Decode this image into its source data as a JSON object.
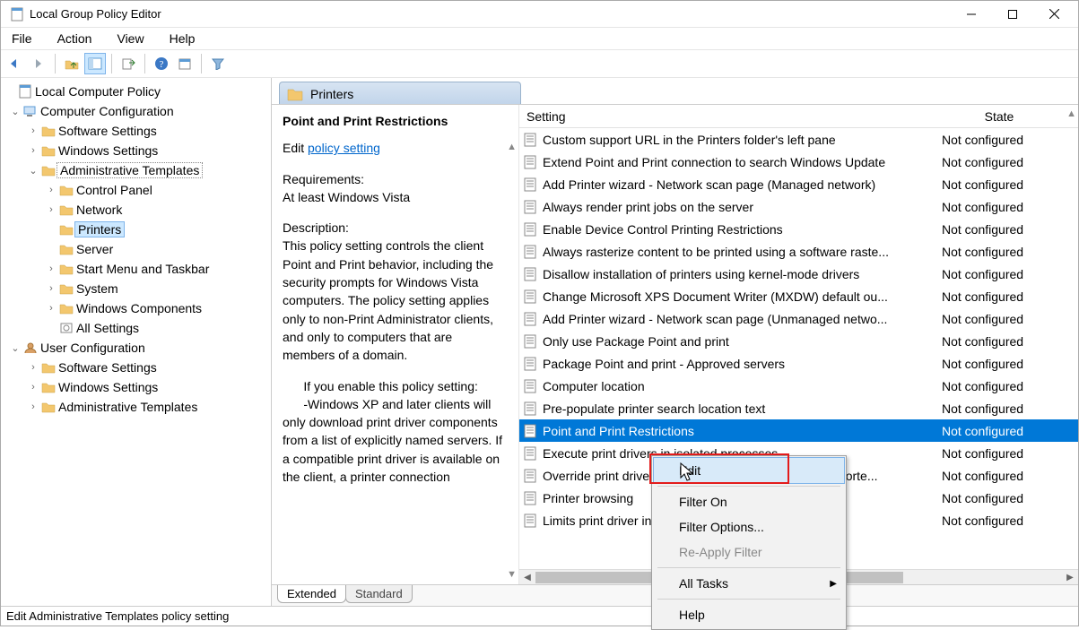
{
  "window": {
    "title": "Local Group Policy Editor"
  },
  "menu": {
    "file": "File",
    "action": "Action",
    "view": "View",
    "help": "Help"
  },
  "tree": {
    "root": "Local Computer Policy",
    "cc": "Computer Configuration",
    "cc_soft": "Software Settings",
    "cc_win": "Windows Settings",
    "cc_adm": "Administrative Templates",
    "cc_adm_cp": "Control Panel",
    "cc_adm_net": "Network",
    "cc_adm_prn": "Printers",
    "cc_adm_srv": "Server",
    "cc_adm_start": "Start Menu and Taskbar",
    "cc_adm_sys": "System",
    "cc_adm_wc": "Windows Components",
    "cc_adm_all": "All Settings",
    "uc": "User Configuration",
    "uc_soft": "Software Settings",
    "uc_win": "Windows Settings",
    "uc_adm": "Administrative Templates"
  },
  "category": {
    "title": "Printers"
  },
  "desc": {
    "title": "Point and Print Restrictions",
    "edit_prefix": "Edit ",
    "edit_link": "policy setting",
    "req_label": "Requirements:",
    "req_text": "At least Windows Vista",
    "desc_label": "Description:",
    "desc_text": "This policy setting controls the client Point and Print behavior, including the security prompts for Windows Vista computers. The policy setting applies only to non-Print Administrator clients, and only to computers that are members of a domain.",
    "enable_text": "      If you enable this policy setting:",
    "enable_bullet": "      -Windows XP and later clients will only download print driver components from a list of explicitly named servers. If a compatible print driver is available on the client, a printer connection"
  },
  "columns": {
    "setting": "Setting",
    "state": "State"
  },
  "settings": [
    {
      "name": "Custom support URL in the Printers folder's left pane",
      "state": "Not configured"
    },
    {
      "name": "Extend Point and Print connection to search Windows Update",
      "state": "Not configured"
    },
    {
      "name": "Add Printer wizard - Network scan page (Managed network)",
      "state": "Not configured"
    },
    {
      "name": "Always render print jobs on the server",
      "state": "Not configured"
    },
    {
      "name": "Enable Device Control Printing Restrictions",
      "state": "Not configured"
    },
    {
      "name": "Always rasterize content to be printed using a software raste...",
      "state": "Not configured"
    },
    {
      "name": "Disallow installation of printers using kernel-mode drivers",
      "state": "Not configured"
    },
    {
      "name": "Change Microsoft XPS Document Writer (MXDW) default ou...",
      "state": "Not configured"
    },
    {
      "name": "Add Printer wizard - Network scan page (Unmanaged netwo...",
      "state": "Not configured"
    },
    {
      "name": "Only use Package Point and print",
      "state": "Not configured"
    },
    {
      "name": "Package Point and print - Approved servers",
      "state": "Not configured"
    },
    {
      "name": "Computer location",
      "state": "Not configured"
    },
    {
      "name": "Pre-populate printer search location text",
      "state": "Not configured"
    },
    {
      "name": "Point and Print Restrictions",
      "state": "Not configured",
      "selected": true
    },
    {
      "name": "Execute print drivers in isolated processes",
      "state": "Not configured"
    },
    {
      "name": "Override print driver execution compatibility setting reporte...",
      "state": "Not configured"
    },
    {
      "name": "Printer browsing",
      "state": "Not configured"
    },
    {
      "name": "Limits print driver installation to Administrators",
      "state": "Not configured"
    }
  ],
  "ctx": {
    "edit": "Edit",
    "filter_on": "Filter On",
    "filter_opt": "Filter Options...",
    "reapply": "Re-Apply Filter",
    "all_tasks": "All Tasks",
    "help": "Help"
  },
  "tabs": {
    "extended": "Extended",
    "standard": "Standard"
  },
  "statusbar": {
    "text": "Edit Administrative Templates policy setting"
  }
}
